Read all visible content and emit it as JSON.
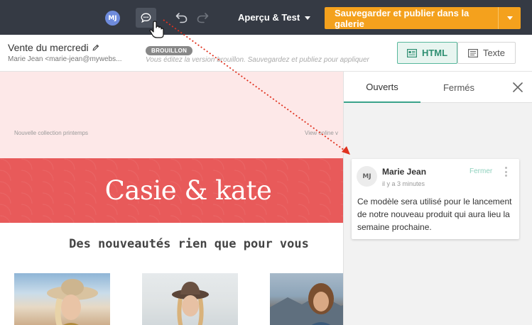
{
  "topbar": {
    "avatar_initials": "MJ",
    "comment_icon": "comment-bubble-icon",
    "undo_icon": "undo-icon",
    "redo_icon": "redo-icon",
    "preview_label": "Aperçu & Test",
    "publish_label": "Sauvegarder et publier dans la galerie",
    "accent_color": "#f4a11d"
  },
  "subheader": {
    "title": "Vente du mercredi",
    "sender": "Marie Jean <marie-jean@mywebs...",
    "status_badge": "BROUILLON",
    "draft_note": "Vous éditez la version brouillon. Sauvegardez et publiez pour appliquer",
    "html_label": "HTML",
    "text_label": "Texte"
  },
  "email": {
    "preheader": "Nouvelle collection printemps",
    "view_online": "View online v",
    "brand": "Casie & kate",
    "tagline": "Des nouveautés rien que pour vous"
  },
  "comments": {
    "tab_open": "Ouverts",
    "tab_closed": "Fermés",
    "items": [
      {
        "initials": "MJ",
        "author": "Marie Jean",
        "time": "il y a 3 minutes",
        "resolve_label": "Fermer",
        "text": "Ce modèle sera utilisé pour le lancement de notre nouveau produit qui aura lieu la semaine prochaine."
      }
    ]
  }
}
